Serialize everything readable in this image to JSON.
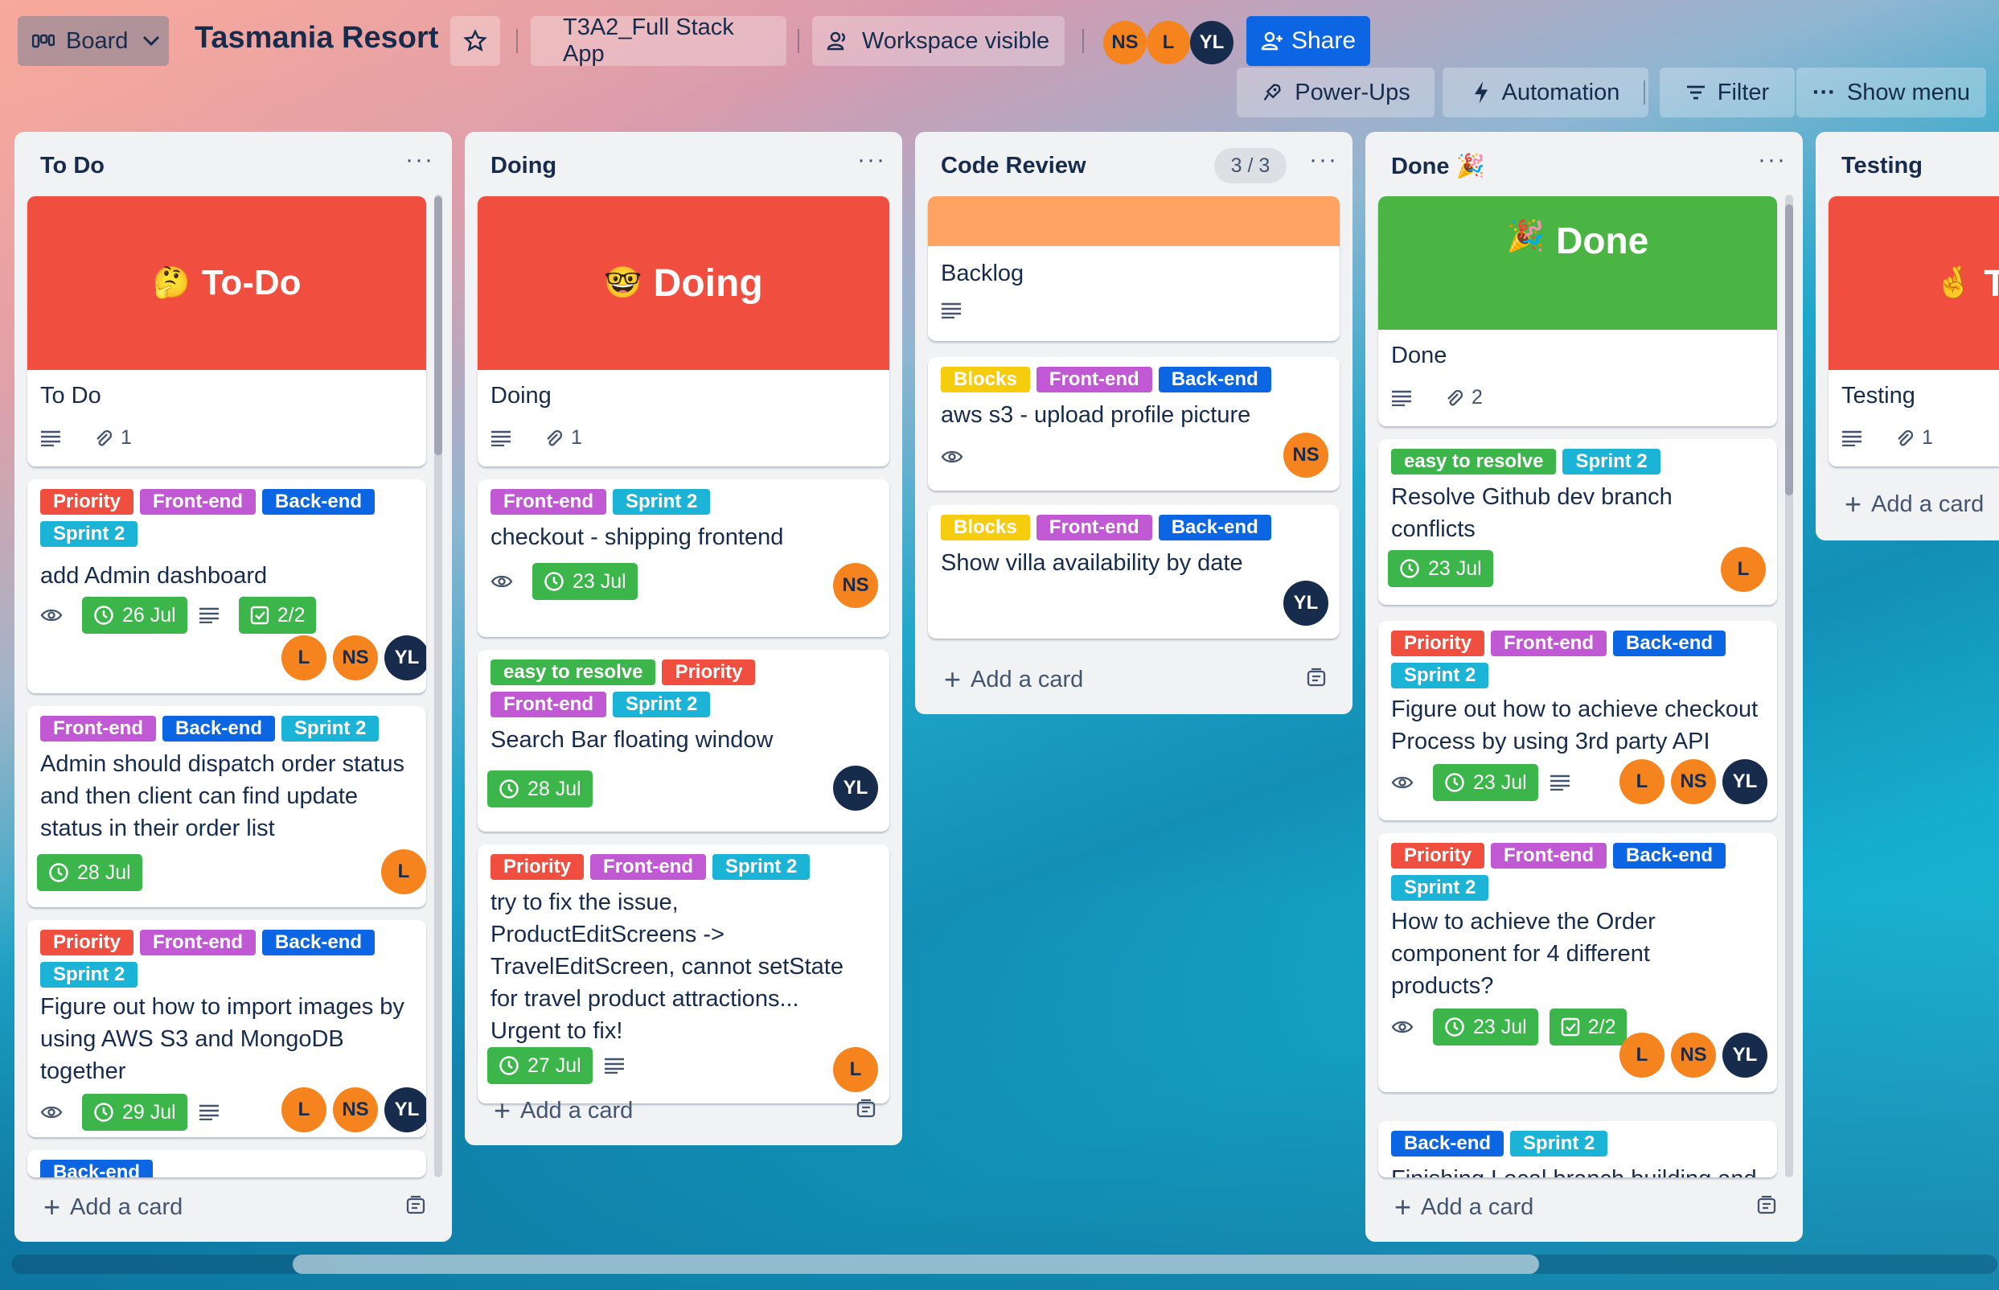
{
  "header": {
    "view_label": "Board",
    "board_title": "Tasmania Resort",
    "workspace_name": "T3A2_Full Stack App",
    "visibility_label": "Workspace visible",
    "members": [
      "NS",
      "L",
      "YL"
    ],
    "share_label": "Share",
    "powerups_label": "Power-Ups",
    "automation_label": "Automation",
    "filter_label": "Filter",
    "show_menu_label": "Show menu"
  },
  "colors": {
    "priority": "#f04e3e",
    "front_end": "#c059d3",
    "back_end": "#0c66e4",
    "sprint": "#1bb4d6",
    "easy": "#3cb64a",
    "blocks": "#f5cd0e",
    "due_green": "#3cb64a"
  },
  "common": {
    "add_card_label": "Add a card",
    "dots": "···"
  },
  "lists": [
    {
      "title": "To Do",
      "cards": [
        {
          "cover_title": "To-Do",
          "cover_emoji": "🤔",
          "title": "To Do",
          "attachments": "1"
        },
        {
          "labels": [
            "Priority",
            "Front-end",
            "Back-end",
            "Sprint 2"
          ],
          "title": "add Admin dashboard",
          "due": "26 Jul",
          "checklist": "2/2",
          "members": [
            "L",
            "NS",
            "YL"
          ]
        },
        {
          "labels": [
            "Front-end",
            "Back-end",
            "Sprint 2"
          ],
          "title": "Admin should dispatch order status and then client can find update status in their order list",
          "due": "28 Jul",
          "members": [
            "L"
          ]
        },
        {
          "labels": [
            "Priority",
            "Front-end",
            "Back-end",
            "Sprint 2"
          ],
          "title": "Figure out how to import images by using AWS S3 and MongoDB together",
          "due": "29 Jul",
          "members": [
            "L",
            "NS",
            "YL"
          ]
        },
        {
          "labels": [
            "Back-end"
          ]
        }
      ]
    },
    {
      "title": "Doing",
      "cards": [
        {
          "cover_title": "Doing",
          "cover_emoji": "🤓",
          "title": "Doing",
          "attachments": "1"
        },
        {
          "labels": [
            "Front-end",
            "Sprint 2"
          ],
          "title": "checkout - shipping frontend",
          "due": "23 Jul",
          "members": [
            "NS"
          ]
        },
        {
          "labels": [
            "easy to resolve",
            "Priority",
            "Front-end",
            "Sprint 2"
          ],
          "title": "Search Bar floating window",
          "due": "28 Jul",
          "members": [
            "YL"
          ]
        },
        {
          "labels": [
            "Priority",
            "Front-end",
            "Sprint 2"
          ],
          "title": "try to fix the issue, ProductEditScreens -> TravelEditScreen, cannot setState for travel product attractions... Urgent to fix!",
          "due": "27 Jul",
          "members": [
            "L"
          ]
        }
      ]
    },
    {
      "title": "Code Review",
      "count": "3 / 3",
      "cards": [
        {
          "title": "Backlog"
        },
        {
          "labels": [
            "Blocks",
            "Front-end",
            "Back-end"
          ],
          "title": "aws s3 - upload profile picture",
          "members": [
            "NS"
          ]
        },
        {
          "labels": [
            "Blocks",
            "Front-end",
            "Back-end"
          ],
          "title": "Show villa availability by date",
          "members": [
            "YL"
          ]
        }
      ]
    },
    {
      "title": "Done",
      "title_emoji": "🎉",
      "cards": [
        {
          "cover_title": "Done",
          "cover_emoji": "🎉",
          "title": "Done",
          "attachments": "2"
        },
        {
          "labels": [
            "easy to resolve",
            "Sprint 2"
          ],
          "title": "Resolve Github dev branch conflicts",
          "due": "23 Jul",
          "members": [
            "L"
          ]
        },
        {
          "labels": [
            "Priority",
            "Front-end",
            "Back-end",
            "Sprint 2"
          ],
          "title": "Figure out how to achieve checkout Process by using 3rd party API",
          "due": "23 Jul",
          "members": [
            "L",
            "NS",
            "YL"
          ]
        },
        {
          "labels": [
            "Priority",
            "Front-end",
            "Back-end",
            "Sprint 2"
          ],
          "title": "How to achieve the Order component for 4 different products?",
          "due": "23 Jul",
          "checklist": "2/2",
          "members": [
            "L",
            "NS",
            "YL"
          ]
        },
        {
          "labels": [
            "Back-end",
            "Sprint 2"
          ],
          "title": "Finishing Local branch building and"
        }
      ]
    },
    {
      "title": "Testing",
      "cards": [
        {
          "cover_title": "Te",
          "cover_emoji": "🤞",
          "title": "Testing",
          "attachments": "1"
        }
      ]
    }
  ]
}
